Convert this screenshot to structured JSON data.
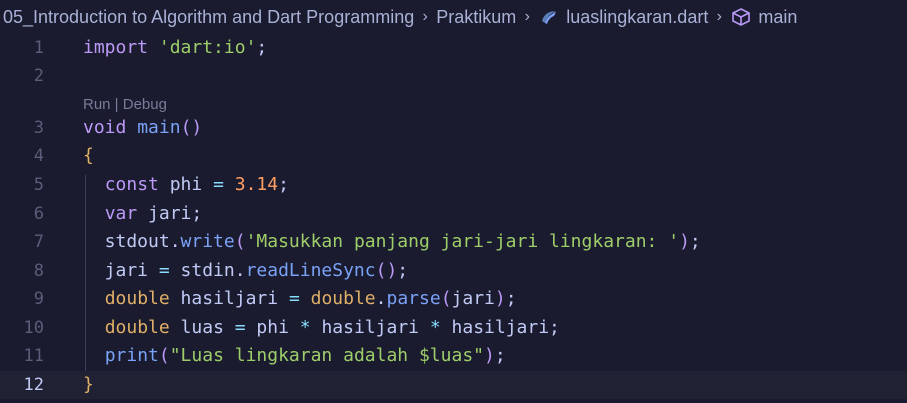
{
  "breadcrumb": {
    "folder": "05_Introduction to Algorithm and Dart Programming",
    "subfolder": "Praktikum",
    "file": "luaslingkaran.dart",
    "symbol": "main",
    "separator": ">"
  },
  "codelens": {
    "text": "Run | Debug"
  },
  "lines": [
    {
      "number": "1",
      "tokens": [
        [
          "kw",
          "import"
        ],
        [
          "plain",
          " "
        ],
        [
          "str",
          "'dart:io'"
        ],
        [
          "plain",
          ";"
        ]
      ]
    },
    {
      "number": "2",
      "tokens": []
    },
    {
      "number": "3",
      "tokens": [
        [
          "kw",
          "void"
        ],
        [
          "plain",
          " "
        ],
        [
          "fn",
          "main"
        ],
        [
          "paren",
          "()"
        ]
      ]
    },
    {
      "number": "4",
      "tokens": [
        [
          "brace",
          "{"
        ]
      ]
    },
    {
      "number": "5",
      "tokens": [
        [
          "plain",
          "  "
        ],
        [
          "kw",
          "const"
        ],
        [
          "plain",
          " phi "
        ],
        [
          "op",
          "="
        ],
        [
          "plain",
          " "
        ],
        [
          "num",
          "3.14"
        ],
        [
          "plain",
          ";"
        ]
      ]
    },
    {
      "number": "6",
      "tokens": [
        [
          "plain",
          "  "
        ],
        [
          "kw",
          "var"
        ],
        [
          "plain",
          " jari;"
        ]
      ]
    },
    {
      "number": "7",
      "tokens": [
        [
          "plain",
          "  stdout."
        ],
        [
          "fn",
          "write"
        ],
        [
          "paren",
          "("
        ],
        [
          "str",
          "'Masukkan panjang jari-jari lingkaran: '"
        ],
        [
          "paren",
          ")"
        ],
        [
          "plain",
          ";"
        ]
      ]
    },
    {
      "number": "8",
      "tokens": [
        [
          "plain",
          "  jari "
        ],
        [
          "op",
          "="
        ],
        [
          "plain",
          " stdin."
        ],
        [
          "fn",
          "readLineSync"
        ],
        [
          "paren",
          "()"
        ],
        [
          "plain",
          ";"
        ]
      ]
    },
    {
      "number": "9",
      "tokens": [
        [
          "plain",
          "  "
        ],
        [
          "type",
          "double"
        ],
        [
          "plain",
          " hasiljari "
        ],
        [
          "op",
          "="
        ],
        [
          "plain",
          " "
        ],
        [
          "type",
          "double"
        ],
        [
          "plain",
          "."
        ],
        [
          "fn",
          "parse"
        ],
        [
          "paren",
          "("
        ],
        [
          "plain",
          "jari"
        ],
        [
          "paren",
          ")"
        ],
        [
          "plain",
          ";"
        ]
      ]
    },
    {
      "number": "10",
      "tokens": [
        [
          "plain",
          "  "
        ],
        [
          "type",
          "double"
        ],
        [
          "plain",
          " luas "
        ],
        [
          "op",
          "="
        ],
        [
          "plain",
          " phi "
        ],
        [
          "op",
          "*"
        ],
        [
          "plain",
          " hasiljari "
        ],
        [
          "op",
          "*"
        ],
        [
          "plain",
          " hasiljari;"
        ]
      ]
    },
    {
      "number": "11",
      "tokens": [
        [
          "plain",
          "  "
        ],
        [
          "fn",
          "print"
        ],
        [
          "paren",
          "("
        ],
        [
          "str",
          "\"Luas lingkaran adalah $luas\""
        ],
        [
          "paren",
          ")"
        ],
        [
          "plain",
          ";"
        ]
      ]
    },
    {
      "number": "12",
      "tokens": [
        [
          "brace",
          "}"
        ]
      ]
    }
  ],
  "current_line": "12",
  "colors": {
    "background": "#1a1b2e",
    "keyword": "#bb9af7",
    "string": "#9ece6a",
    "number": "#ff9e64",
    "function": "#7aa2f7",
    "type": "#e0af68"
  },
  "icons": {
    "file_icon": "dart-file-icon",
    "symbol_icon": "cube-symbol-icon"
  }
}
